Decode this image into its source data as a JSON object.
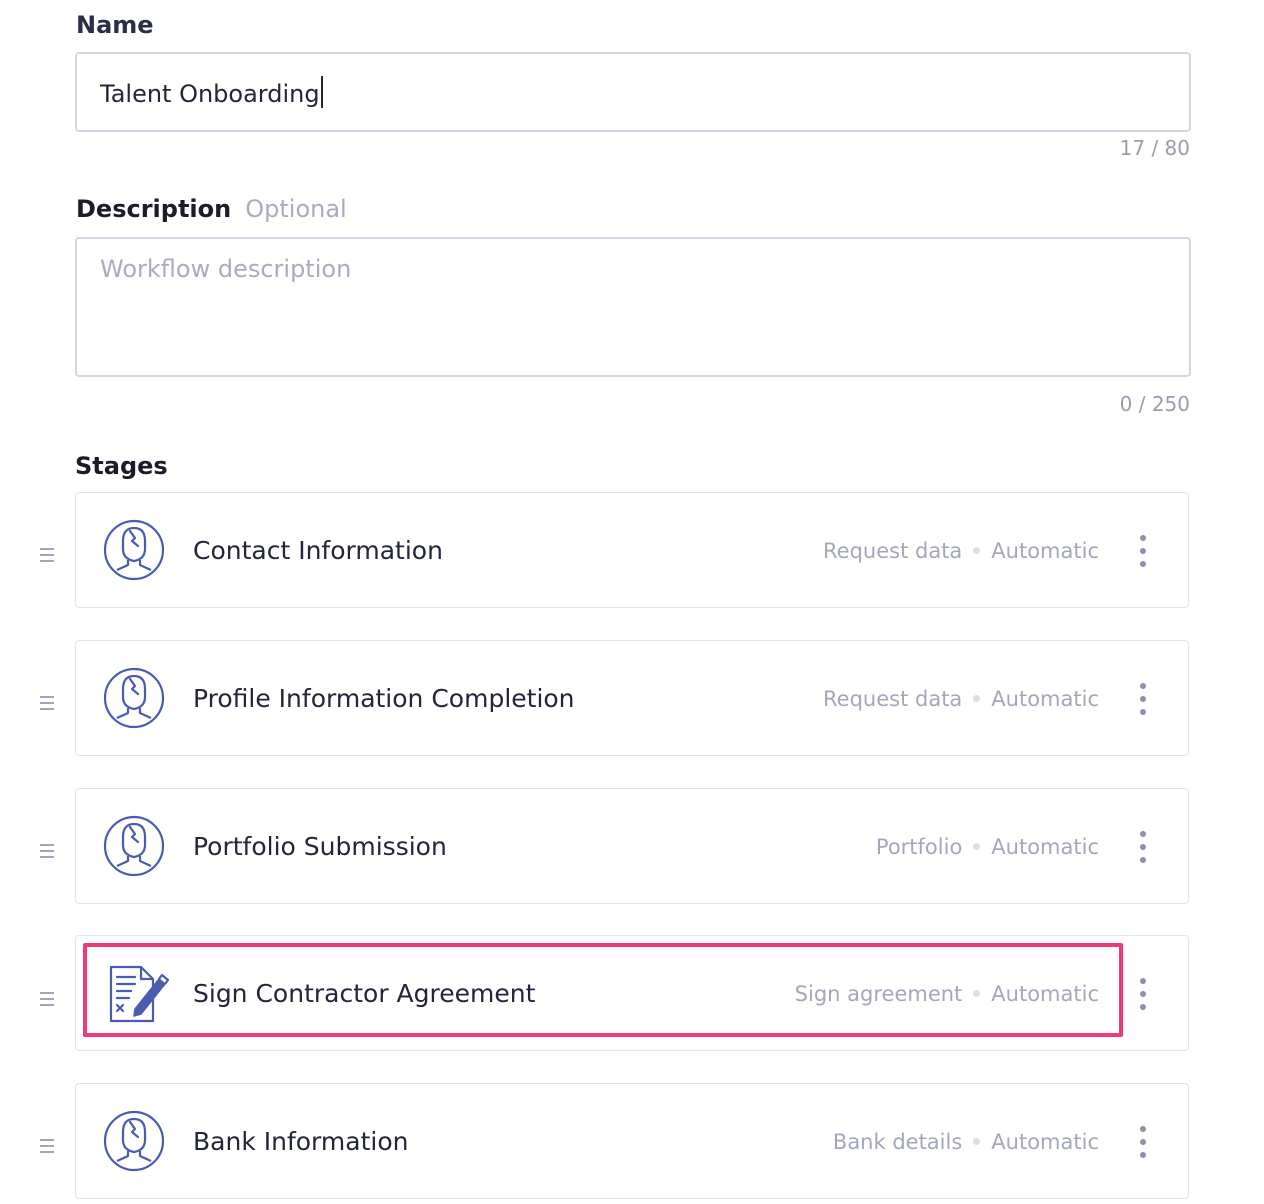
{
  "form": {
    "name_label": "Name",
    "name_value": "Talent Onboarding",
    "name_counter": "17 / 80",
    "description_label": "Description",
    "description_optional": "Optional",
    "description_placeholder": "Workflow description",
    "description_counter": "0 / 250",
    "stages_label": "Stages"
  },
  "stages": [
    {
      "title": "Contact Information",
      "type": "Request data",
      "mode": "Automatic",
      "icon": "person-icon"
    },
    {
      "title": "Profile Information Completion",
      "type": "Request data",
      "mode": "Automatic",
      "icon": "person-icon"
    },
    {
      "title": "Portfolio Submission",
      "type": "Portfolio",
      "mode": "Automatic",
      "icon": "person-icon"
    },
    {
      "title": "Sign Contractor Agreement",
      "type": "Sign agreement",
      "mode": "Automatic",
      "icon": "sign-document-icon",
      "highlighted": true
    },
    {
      "title": "Bank Information",
      "type": "Bank details",
      "mode": "Automatic",
      "icon": "person-icon"
    }
  ],
  "colors": {
    "accent": "#4a5bb0",
    "highlight": "#ee3b74",
    "border": "#d4d6e3",
    "muted_text": "#a4a7bb"
  }
}
